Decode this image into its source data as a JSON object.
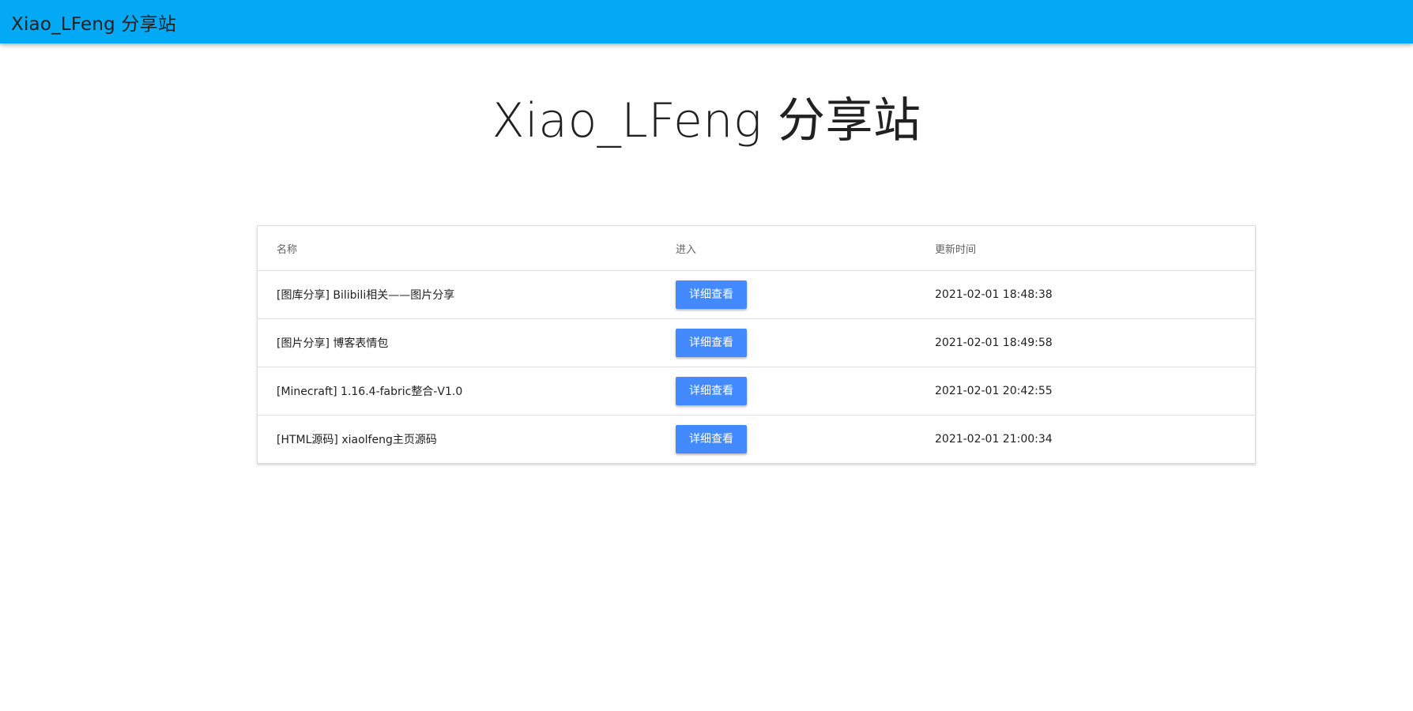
{
  "appbar": {
    "title": "Xiao_LFeng 分享站"
  },
  "page": {
    "heading": "Xiao_LFeng 分享站"
  },
  "table": {
    "headers": {
      "name": "名称",
      "enter": "进入",
      "updated": "更新时间"
    },
    "rows": [
      {
        "name": "[图库分享] Bilibili相关——图片分享",
        "button": "详细查看",
        "updated": "2021-02-01 18:48:38"
      },
      {
        "name": "[图片分享] 博客表情包",
        "button": "详细查看",
        "updated": "2021-02-01 18:49:58"
      },
      {
        "name": "[Minecraft] 1.16.4-fabric整合-V1.0",
        "button": "详细查看",
        "updated": "2021-02-01 20:42:55"
      },
      {
        "name": "[HTML源码] xiaolfeng主页源码",
        "button": "详细查看",
        "updated": "2021-02-01 21:00:34"
      }
    ]
  },
  "colors": {
    "appbar": "#03a9f4",
    "button": "#448aff"
  }
}
